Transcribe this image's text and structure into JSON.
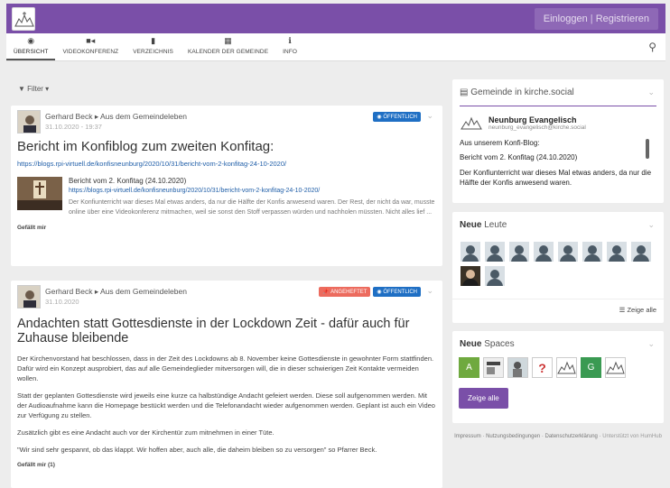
{
  "auth": {
    "login": "Einloggen",
    "register": "Registrieren"
  },
  "nav": {
    "items": [
      {
        "label": "ÜBERSICHT",
        "icon": "dashboard-icon"
      },
      {
        "label": "VIDEOKONFERENZ",
        "icon": "video-icon"
      },
      {
        "label": "VERZEICHNIS",
        "icon": "book-icon"
      },
      {
        "label": "KALENDER DER GEMEINDE",
        "icon": "calendar-icon"
      },
      {
        "label": "INFO",
        "icon": "info-icon"
      }
    ],
    "search_icon": "search-icon"
  },
  "filter": {
    "label": "Filter"
  },
  "post1": {
    "author": "Gerhard Beck",
    "space": "Aus dem Gemeindeleben",
    "date": "31.10.2020 - 19:37",
    "badge_public": "ÖFFENTLICH",
    "title": "Bericht im Konfiblog zum zweiten Konfitag:",
    "link": "https://blogs.rpi-virtuell.de/konfisneunburg/2020/10/31/bericht-vom-2-konfitag-24-10-2020/",
    "preview_title": "Bericht vom 2. Konfitag (24.10.2020)",
    "preview_link": "https://blogs.rpi-virtuell.de/konfisneunburg/2020/10/31/bericht-vom-2-konfitag-24-10-2020/",
    "preview_text": "Der Konfiunterricht war dieses Mal etwas anders, da nur die Hälfte der Konfis anwesend waren. Der Rest, der nicht da war, musste online über eine Videokonferenz mitmachen, weil sie sonst den Stoff verpassen würden und nachholen müssten. Nicht alles lief ...",
    "like": "Gefällt mir"
  },
  "post2": {
    "author": "Gerhard Beck",
    "space": "Aus dem Gemeindeleben",
    "date": "31.10.2020",
    "badge_pinned": "ANGEHEFTET",
    "badge_public": "ÖFFENTLICH",
    "title": "Andachten statt Gottesdienste in der Lockdown Zeit - dafür auch für Zuhause bleibende",
    "paragraphs": [
      "Der Kirchenvorstand hat beschlossen, dass in der Zeit des Lockdowns ab 8. November keine Gottesdienste in gewohnter Form stattfinden. Dafür wird ein Konzept ausprobiert, das auf alle Gemeindeglieder mitversorgen will, die in dieser schwierigen Zeit Kontakte vermeiden wollen.",
      "Statt der geplanten Gottesdienste wird jeweils eine kurze ca halbstündige Andacht gefeiert werden. Diese soll aufgenommen werden. Mit der Audioaufnahme kann die Homepage bestückt werden und die Telefonandacht wieder aufgenommen werden. Geplant ist auch ein Video zur Verfügung zu stellen.",
      "Zusätzlich gibt es eine Andacht auch vor der Kirchentür zum mitnehmen in einer Tüte.",
      "\"Wir sind sehr gespannt, ob das klappt. Wir hoffen aber, auch alle, die daheim bleiben so zu versorgen\" so Pfarrer Beck."
    ],
    "like": "Gefällt mir (1)"
  },
  "social": {
    "header": "Gemeinde in kirche.social",
    "name": "Neunburg Evangelisch",
    "handle": "neunburg_evangelisch@kirche.social",
    "lines": [
      "Aus unserem Konfi-Blog:",
      "Bericht vom 2. Konfitag (24.10.2020)",
      "Der Konfiunterricht war dieses Mal etwas anders, da nur die Hälfte der Konfis anwesend waren."
    ]
  },
  "people": {
    "header_bold": "Neue",
    "header_rest": "Leute",
    "show_all": "Zeige alle"
  },
  "spaces": {
    "header_bold": "Neue",
    "header_rest": "Spaces",
    "icons": [
      "A",
      "",
      "",
      "?",
      "",
      "G",
      ""
    ],
    "show_all": "Zeige alle"
  },
  "footer": {
    "links": [
      "Impressum",
      "Nutzungsbedingungen",
      "Datenschutzerklärung"
    ],
    "powered": "Unterstützt von HumHub"
  }
}
